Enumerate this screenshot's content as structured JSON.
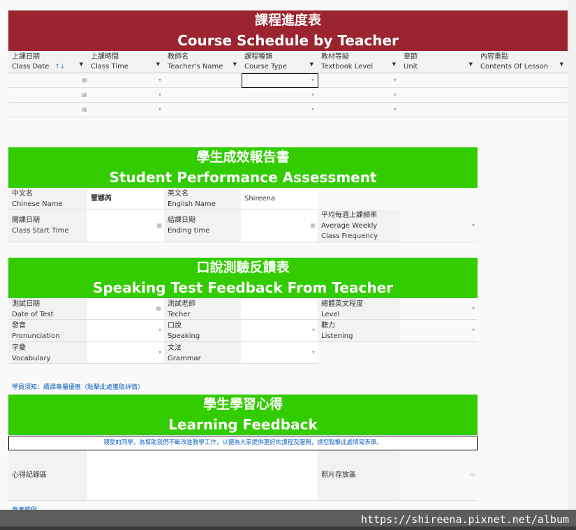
{
  "schedule": {
    "title_zh": "課程進度表",
    "title_en": "Course Schedule by Teacher",
    "header_color": "#9b2430",
    "columns": [
      {
        "zh": "上課日期",
        "en": "Class Date"
      },
      {
        "zh": "上課時間",
        "en": "Class Time"
      },
      {
        "zh": "教師名",
        "en": "Teacher's Name"
      },
      {
        "zh": "課程種類",
        "en": "Course Type"
      },
      {
        "zh": "教材等級",
        "en": "Textbook Level"
      },
      {
        "zh": "章節",
        "en": "Unit"
      },
      {
        "zh": "內容重點",
        "en": "Contents Of Lesson"
      }
    ],
    "sort_icon": "sort-icon",
    "rows": 3
  },
  "performance": {
    "title_zh": "學生成效報告書",
    "title_en": "Student Performance Assessment",
    "header_color": "#33cc00",
    "chinese_name": {
      "zh": "中文名",
      "en": "Chinese Name",
      "value": "雪娜芮"
    },
    "english_name": {
      "zh": "英文名",
      "en": "English Name",
      "value": "Shireena"
    },
    "start": {
      "zh": "開課日期",
      "en": "Class Start Time"
    },
    "end": {
      "zh": "結課日期",
      "en": "Ending time"
    },
    "freq": {
      "zh": "平均每週上課頻率",
      "en": "Average Weekly Class Frequency"
    }
  },
  "speaking": {
    "title_zh": "口說測驗反饋表",
    "title_en": "Speaking Test Feedback From Teacher",
    "fields": [
      {
        "zh": "測試日期",
        "en": "Date of Test"
      },
      {
        "zh": "測試老師",
        "en": "Techer"
      },
      {
        "zh": "總體英文程度",
        "en": "Level"
      },
      {
        "zh": "發音",
        "en": "Pronunciation"
      },
      {
        "zh": "口說",
        "en": "Speaking"
      },
      {
        "zh": "聽力",
        "en": "Listening"
      },
      {
        "zh": "字彙",
        "en": "Vocabulary"
      },
      {
        "zh": "文法",
        "en": "Grammar"
      }
    ]
  },
  "notice_link": "學員須知：續課專屬優惠（點擊此處獲取詳情）",
  "learning": {
    "title_zh": "學生學習心得",
    "title_en": "Learning Feedback",
    "notice": "親愛的同學，為幫助我們不斷改進教學工作，以便為大家提供更好的課程及服務，請您點擊此處填寫表單。",
    "record_label": "心得記錄區",
    "photo_label": "照片存放區"
  },
  "reference_link": "參考範例",
  "watermark": "https://shireena.pixnet.net/album"
}
